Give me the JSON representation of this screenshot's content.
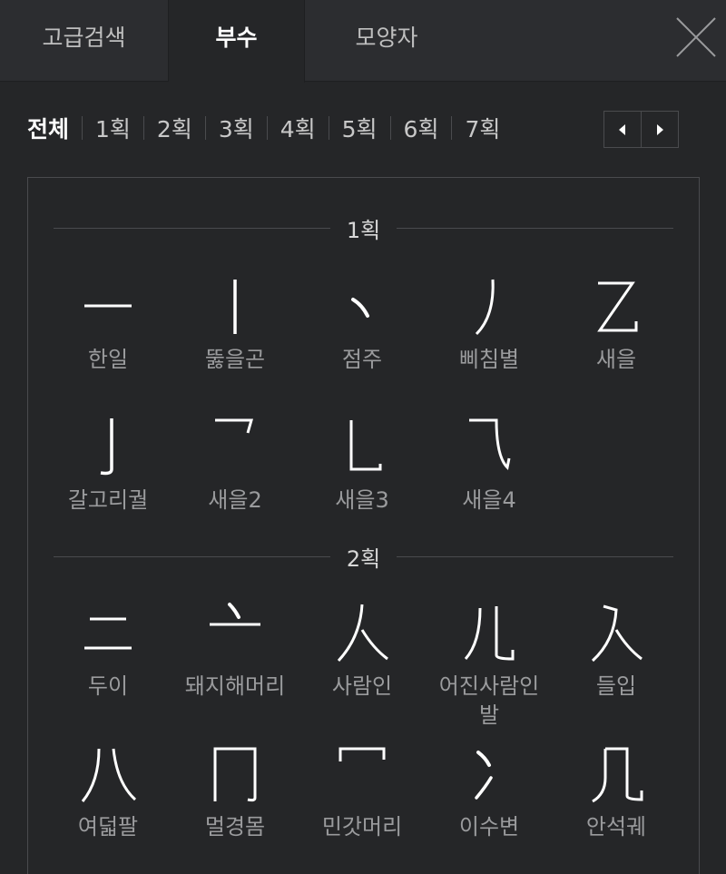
{
  "tabs": [
    "고급검색",
    "부수",
    "모양자"
  ],
  "strokes": [
    "전체",
    "1획",
    "2획",
    "3획",
    "4획",
    "5획",
    "6획",
    "7획"
  ],
  "sections": [
    {
      "title": "1획",
      "items": [
        {
          "name": "한일",
          "glyph": "yi"
        },
        {
          "name": "뚫을곤",
          "glyph": "gun"
        },
        {
          "name": "점주",
          "glyph": "zhu"
        },
        {
          "name": "삐침별",
          "glyph": "pie"
        },
        {
          "name": "새을",
          "glyph": "yi2"
        },
        {
          "name": "갈고리궐",
          "glyph": "jue"
        },
        {
          "name": "새을2",
          "glyph": "yi22"
        },
        {
          "name": "새을3",
          "glyph": "yi23"
        },
        {
          "name": "새을4",
          "glyph": "yi24"
        }
      ]
    },
    {
      "title": "2획",
      "items": [
        {
          "name": "두이",
          "glyph": "er"
        },
        {
          "name": "돼지해머리",
          "glyph": "tou"
        },
        {
          "name": "사람인",
          "glyph": "ren"
        },
        {
          "name": "어진사람인발",
          "glyph": "er2"
        },
        {
          "name": "들입",
          "glyph": "ru"
        },
        {
          "name": "여덟팔",
          "glyph": "ba"
        },
        {
          "name": "멀경몸",
          "glyph": "jiong"
        },
        {
          "name": "민갓머리",
          "glyph": "mi"
        },
        {
          "name": "이수변",
          "glyph": "bing"
        },
        {
          "name": "안석궤",
          "glyph": "ji"
        }
      ]
    }
  ]
}
